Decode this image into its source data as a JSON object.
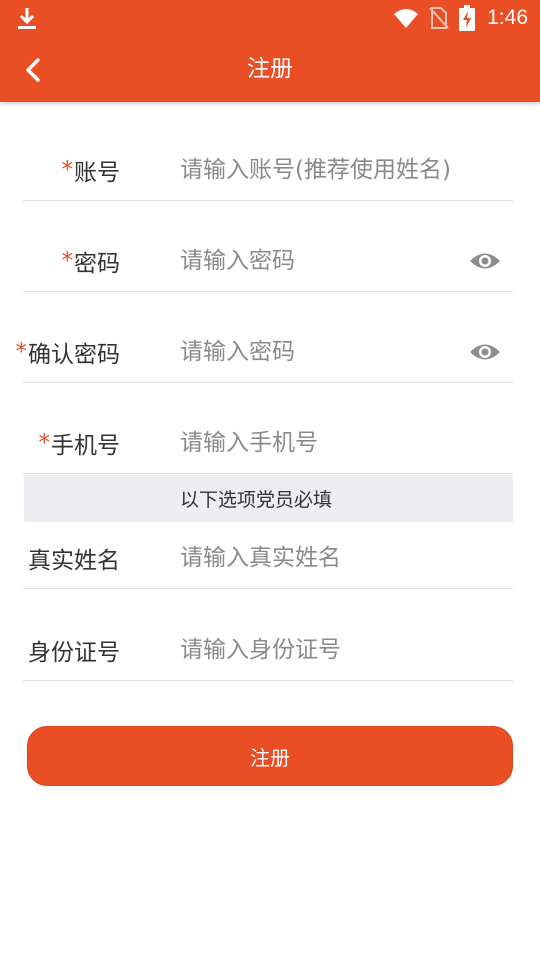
{
  "status_bar": {
    "time": "1:46",
    "icons": [
      "download-icon",
      "wifi-icon",
      "no-sim-icon",
      "battery-charging-icon"
    ]
  },
  "header": {
    "title": "注册",
    "back_icon": "chevron-left-icon"
  },
  "form": {
    "account": {
      "required_mark": "*",
      "label": "账号",
      "placeholder": "请输入账号(推荐使用姓名)",
      "value": ""
    },
    "password": {
      "required_mark": "*",
      "label": "密码",
      "placeholder": "请输入密码",
      "value": "",
      "toggle_icon": "eye-icon"
    },
    "confirm_password": {
      "required_mark": "*",
      "label": "确认密码",
      "placeholder": "请输入密码",
      "value": "",
      "toggle_icon": "eye-icon"
    },
    "phone": {
      "required_mark": "*",
      "label": "手机号",
      "placeholder": "请输入手机号",
      "value": ""
    },
    "section_note": "以下选项党员必填",
    "real_name": {
      "label": "真实姓名",
      "placeholder": "请输入真实姓名",
      "value": ""
    },
    "id_number": {
      "label": "身份证号",
      "placeholder": "请输入身份证号",
      "value": ""
    }
  },
  "submit": {
    "label": "注册"
  },
  "colors": {
    "brand": "#E94E24",
    "divider": "#dedede",
    "section_bg": "#EDEDF2",
    "placeholder": "#8a8a8a"
  }
}
